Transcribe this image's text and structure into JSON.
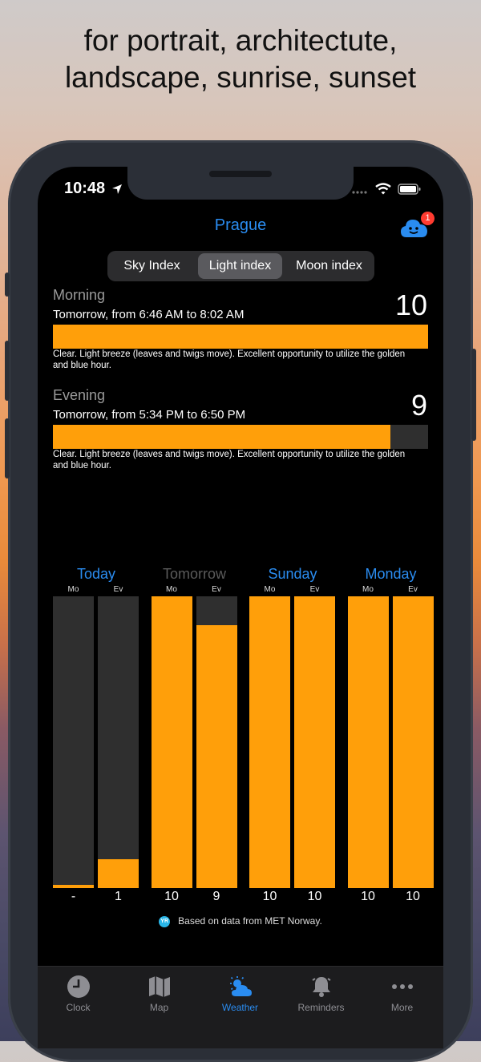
{
  "headline": {
    "line1": "for portrait, architectute,",
    "line2": "landscape, sunrise, sunset"
  },
  "status_bar": {
    "time": "10:48"
  },
  "header": {
    "city": "Prague",
    "badge_count": "1"
  },
  "segments": [
    {
      "label": "Sky Index",
      "active": false
    },
    {
      "label": "Light index",
      "active": true
    },
    {
      "label": "Moon index",
      "active": false
    }
  ],
  "periods": [
    {
      "name": "Morning",
      "when": "Tomorrow, from 6:46 AM to 8:02 AM",
      "score": "10",
      "fraction": 1.0,
      "description": "Clear. Light breeze (leaves and twigs move). Excellent opportunity to utilize the golden and blue hour."
    },
    {
      "name": "Evening",
      "when": "Tomorrow, from 5:34 PM to 6:50 PM",
      "score": "9",
      "fraction": 0.9,
      "description": "Clear. Light breeze (leaves and twigs move). Excellent opportunity to utilize the golden and blue hour."
    }
  ],
  "chart_data": {
    "type": "bar",
    "days": [
      {
        "label": "Today",
        "color": "#2a8cf0",
        "morning_label": "Mo",
        "evening_label": "Ev",
        "morning_value": "-",
        "evening_value": "1",
        "morning_fraction": 0.01,
        "evening_fraction": 0.1
      },
      {
        "label": "Tomorrow",
        "color": "#5a5a5a",
        "morning_label": "Mo",
        "evening_label": "Ev",
        "morning_value": "10",
        "evening_value": "9",
        "morning_fraction": 1.0,
        "evening_fraction": 0.9
      },
      {
        "label": "Sunday",
        "color": "#2a8cf0",
        "morning_label": "Mo",
        "evening_label": "Ev",
        "morning_value": "10",
        "evening_value": "10",
        "morning_fraction": 1.0,
        "evening_fraction": 1.0
      },
      {
        "label": "Monday",
        "color": "#2a8cf0",
        "morning_label": "Mo",
        "evening_label": "Ev",
        "morning_value": "10",
        "evening_value": "10",
        "morning_fraction": 1.0,
        "evening_fraction": 1.0
      }
    ],
    "ylim": [
      0,
      10
    ]
  },
  "credit": {
    "badge": "YR",
    "text": "Based on data from MET Norway."
  },
  "tabs": [
    {
      "label": "Clock",
      "icon": "clock-icon",
      "active": false
    },
    {
      "label": "Map",
      "icon": "map-icon",
      "active": false
    },
    {
      "label": "Weather",
      "icon": "weather-icon",
      "active": true
    },
    {
      "label": "Reminders",
      "icon": "bell-icon",
      "active": false
    },
    {
      "label": "More",
      "icon": "more-icon",
      "active": false
    }
  ],
  "colors": {
    "accent": "#2a8cf0",
    "bar": "#ff9f0a",
    "track": "#2f2f2f"
  }
}
